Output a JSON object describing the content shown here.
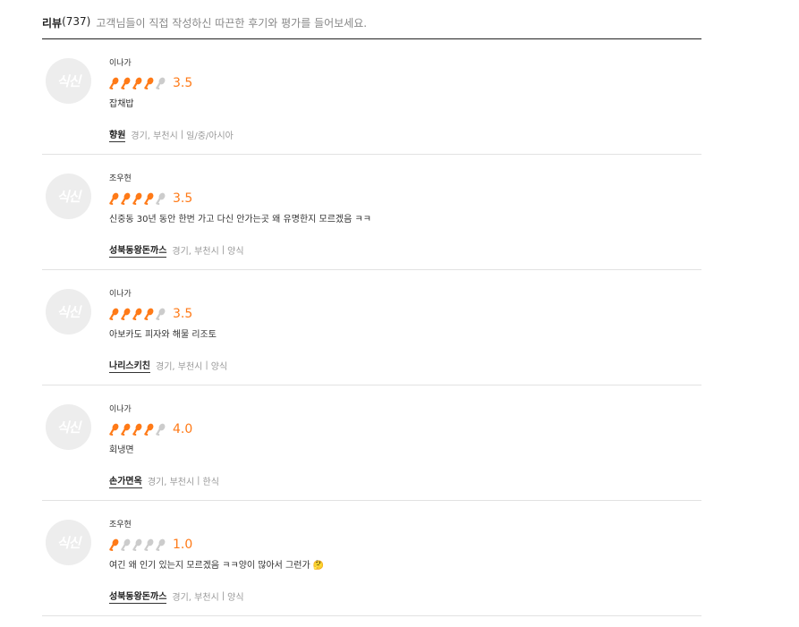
{
  "header": {
    "title": "리뷰",
    "count": "(737)",
    "description": "고객님들이 직접 작성하신 따끈한 후기와 평가를 들어보세요."
  },
  "colors": {
    "accent": "#ff7a17",
    "star_empty": "#cccccc"
  },
  "avatar_text": "식신",
  "reviews": [
    {
      "user": "이나가",
      "rating": 3.5,
      "score": "3.5",
      "comment": "잡채밥",
      "restaurant": "향원",
      "location": "경기, 부천시",
      "category": "일/중/아시아"
    },
    {
      "user": "조우현",
      "rating": 3.5,
      "score": "3.5",
      "comment": "신중동 30년 동안 한번 가고 다신 안가는곳 왜 유명한지 모르겠음 ㅋㅋ",
      "restaurant": "성북동왕돈까스",
      "location": "경기, 부천시",
      "category": "양식"
    },
    {
      "user": "이나가",
      "rating": 3.5,
      "score": "3.5",
      "comment": "아보카도 피자와 해물 리조토",
      "restaurant": "나리스키친",
      "location": "경기, 부천시",
      "category": "양식"
    },
    {
      "user": "이나가",
      "rating": 4.0,
      "score": "4.0",
      "comment": "회냉면",
      "restaurant": "손가면옥",
      "location": "경기, 부천시",
      "category": "한식"
    },
    {
      "user": "조우현",
      "rating": 1.0,
      "score": "1.0",
      "comment": "여긴 왜 인기 있는지 모르겠음 ㅋㅋ양이 많아서 그런가 🤔",
      "restaurant": "성북동왕돈까스",
      "location": "경기, 부천시",
      "category": "양식"
    }
  ]
}
